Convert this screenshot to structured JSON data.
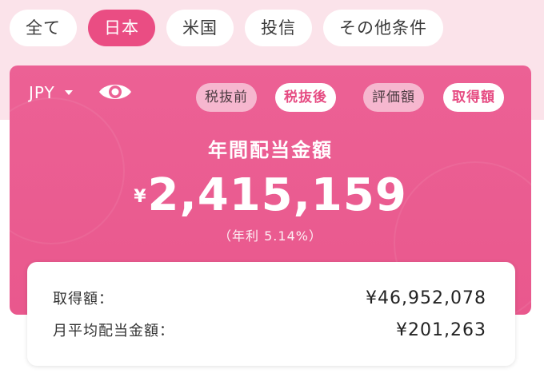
{
  "tabs": [
    {
      "label": "全て",
      "active": false
    },
    {
      "label": "日本",
      "active": true
    },
    {
      "label": "米国",
      "active": false
    },
    {
      "label": "投信",
      "active": false
    },
    {
      "label": "その他条件",
      "active": false
    }
  ],
  "card": {
    "currency": "JPY",
    "eye_icon": "eye-icon",
    "tax_toggle": {
      "before": "税抜前",
      "after": "税抜後",
      "selected": "after"
    },
    "basis_toggle": {
      "valuation": "評価額",
      "acquisition": "取得額",
      "selected": "acquisition"
    },
    "title": "年間配当金額",
    "currency_symbol": "¥",
    "amount": "2,415,159",
    "yield_text": "（年利 5.14%）"
  },
  "summary": {
    "acquisition_label": "取得額：",
    "acquisition_value": "¥46,952,078",
    "monthly_label": "月平均配当金額：",
    "monthly_value": "¥201,263"
  },
  "colors": {
    "accent": "#ea4d83",
    "card_bg": "#ec6195",
    "page_tint": "#fbe3ea"
  }
}
